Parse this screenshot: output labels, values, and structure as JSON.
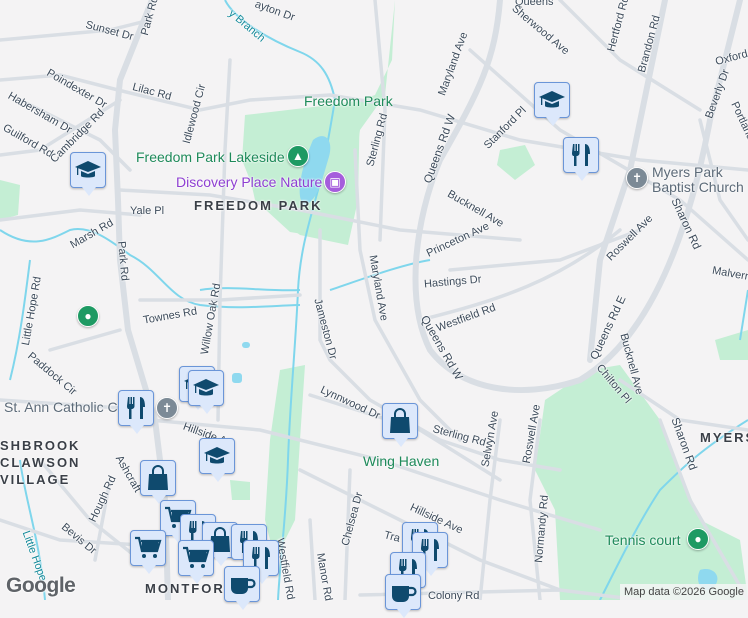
{
  "streets": {
    "sunset_dr": "Sunset Dr",
    "park_rd_top": "Park Rd",
    "park_rd": "Park Rd",
    "poindexter_dr": "Poindexter Dr",
    "lilac_rd": "Lilac Rd",
    "habersham_dr": "Habersham Dr",
    "guilford_rd": "Guilford Rd",
    "cambridge_rd": "Cambridge Rd",
    "idlewood_cir": "Idlewood Cir",
    "dayton_dr": "ayton Dr",
    "yale_pl": "Yale Pl",
    "marsh_rd": "Marsh Rd",
    "sterling_rd_top": "Sterling Rd",
    "maryland_ave_top": "Maryland Ave",
    "queens_rd_w_top": "Queens Rd W",
    "queens_top": "Queens",
    "sherwood_ave": "Sherwood Ave",
    "hertford_rd": "Hertford Rd",
    "brandon_rd": "Brandon Rd",
    "oxford": "Oxford",
    "beverly_dr": "Beverly Dr",
    "portland": "Portland",
    "stanford_pl": "Stanford Pl",
    "bucknell_ave_top": "Bucknell Ave",
    "princeton_ave": "Princeton Ave",
    "hastings_dr": "Hastings Dr",
    "roswell_ave_top": "Roswell Ave",
    "sharon_rd_top": "Sharon Rd",
    "malvern": "Malvern",
    "maryland_ave": "Maryland Ave",
    "westfield_rd_top": "Westfield Rd",
    "queens_rd_w": "Queens Rd W",
    "queens_rd_e": "Queens Rd E",
    "bucknell_ave": "Bucknell Ave",
    "chilton_pl": "Chilton Pl",
    "jameston_dr": "Jameston Dr",
    "townes_rd": "Townes Rd",
    "willow_oak_rd": "Willow Oak Rd",
    "little_hope_rd": "Little Hope Rd",
    "paddock_cir": "Paddock Cir",
    "hillside_ave_left": "Hillside A",
    "ashcraft": "Ashcraft",
    "hough_rd": "Hough Rd",
    "bevis_dr": "Bevis Dr",
    "lynnwood_dr": "Lynnwood Dr",
    "sterling_rd": "Sterling Rd",
    "selwyn_ave": "Selwyn Ave",
    "roswell_ave": "Roswell Ave",
    "sharon_rd": "Sharon Rd",
    "chelsea_dr": "Chelsea Dr",
    "manor_rd": "Manor Rd",
    "westfield_rd": "Westfield Rd",
    "hillside_ave": "Hillside Ave",
    "tra": "Tra",
    "normandy_rd": "Normandy Rd",
    "colony_rd": "Colony Rd"
  },
  "water": {
    "branch": "y Branch",
    "little_hope": "Little Hope"
  },
  "places": {
    "freedom_park": "Freedom Park",
    "freedom_park_lakeside": "Freedom Park Lakeside",
    "discovery_place_nature": "Discovery Place Nature",
    "myers_park_baptist_church_1": "Myers Park",
    "myers_park_baptist_church_2": "Baptist Church",
    "st_ann_catholic": "St. Ann Catholic C",
    "wing_haven": "Wing Haven",
    "tennis_court": "Tennis court"
  },
  "neighborhoods": {
    "freedom_park": "FREEDOM PARK",
    "ashbrook_1": "SHBROOK",
    "ashbrook_2": "CLAWSON",
    "ashbrook_3": "VILLAGE",
    "myers": "MYERS",
    "montford": "MONTFORD"
  },
  "footer": {
    "logo": "Google",
    "attribution": "Map data ©2026 Google"
  },
  "colors": {
    "background": "#f4f3f4",
    "park": "#c4eed4",
    "water": "#7fd6ec",
    "road": "#d9dee4",
    "marker_fill": "#dce8fb",
    "marker_icon": "#0f4a6e"
  }
}
